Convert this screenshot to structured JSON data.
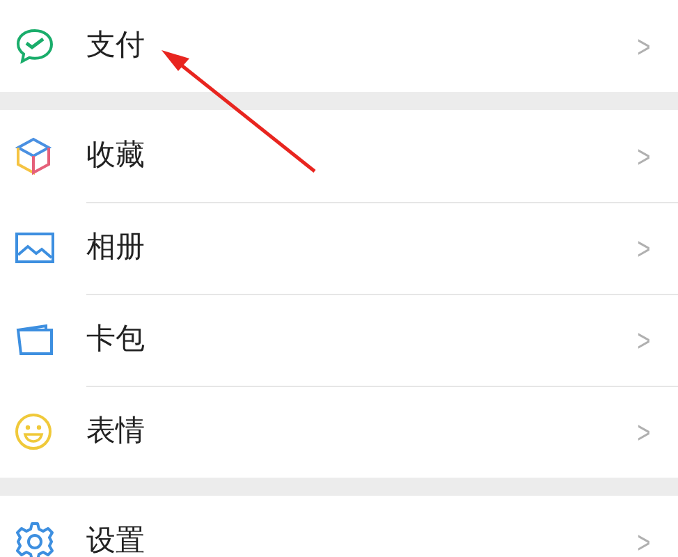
{
  "sections": [
    {
      "items": [
        {
          "kind": "pay",
          "label": "支付",
          "chevron": ">"
        }
      ]
    },
    {
      "items": [
        {
          "kind": "favorites",
          "label": "收藏",
          "chevron": ">"
        },
        {
          "kind": "album",
          "label": "相册",
          "chevron": ">"
        },
        {
          "kind": "cards",
          "label": "卡包",
          "chevron": ">"
        },
        {
          "kind": "stickers",
          "label": "表情",
          "chevron": ">"
        }
      ]
    },
    {
      "items": [
        {
          "kind": "settings",
          "label": "设置",
          "chevron": ">"
        }
      ]
    }
  ],
  "annotation": {
    "kind": "arrow"
  }
}
